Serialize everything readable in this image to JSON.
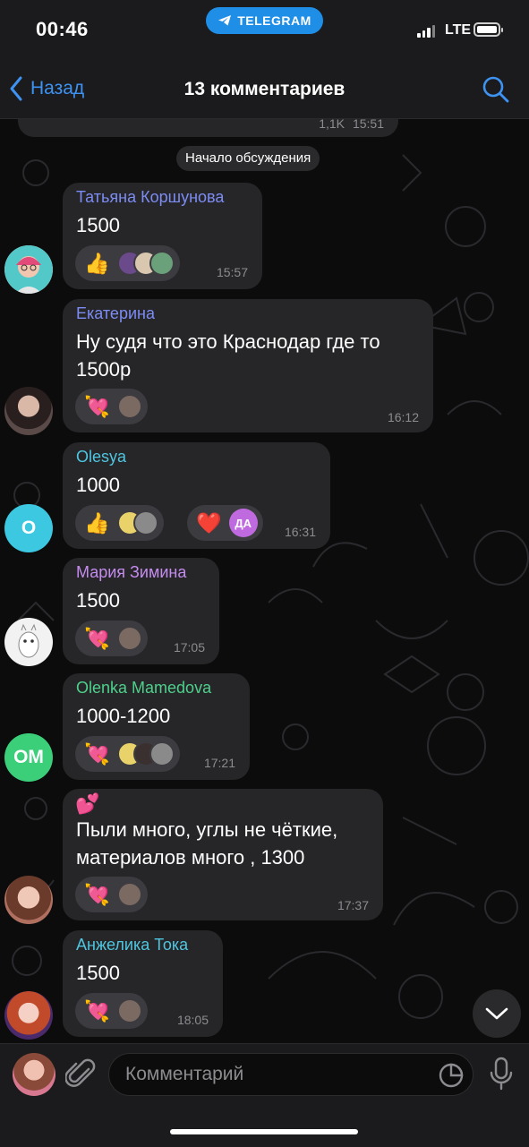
{
  "status": {
    "time": "00:46",
    "app_pill": "TELEGRAM",
    "network": "LTE"
  },
  "nav": {
    "back_label": "Назад",
    "title": "13 комментариев",
    "search_icon": "search-icon"
  },
  "partial_message": {
    "views": "1,1K",
    "time": "15:51"
  },
  "divider": "Начало обсуждения",
  "comments": [
    {
      "name": "Татьяна Коршунова",
      "name_color": "#7c8cf3",
      "text": [
        "1500"
      ],
      "time": "15:57",
      "reactions": [
        {
          "icon": "thumbs-up",
          "emoji": "👍",
          "avatars": 3
        }
      ]
    },
    {
      "name": "Екатерина",
      "name_color": "#7c8cf3",
      "text": [
        "Ну судя что это Краснодар где то",
        "1500р"
      ],
      "time": "16:12",
      "reactions": [
        {
          "icon": "heart-with-arrow",
          "emoji": "💘",
          "avatars": 1
        }
      ]
    },
    {
      "name": "Olesya",
      "name_color": "#4fc6e0",
      "avatar_letter": "O",
      "text": [
        "1000"
      ],
      "time": "16:31",
      "reactions": [
        {
          "icon": "thumbs-up",
          "emoji": "👍",
          "avatars": 2
        },
        {
          "icon": "red-heart",
          "emoji": "❤️",
          "avatar_text": "ДА"
        }
      ]
    },
    {
      "name": "Мария Зимина",
      "name_color": "#c58cf0",
      "text": [
        "1500"
      ],
      "time": "17:05",
      "reactions": [
        {
          "icon": "heart-with-arrow",
          "emoji": "💘",
          "avatars": 1
        }
      ]
    },
    {
      "name": "Olenka Mamedova",
      "name_color": "#4ed08c",
      "avatar_letter": "OM",
      "text": [
        "1000-1200"
      ],
      "time": "17:21",
      "reactions": [
        {
          "icon": "heart-with-arrow",
          "emoji": "💘",
          "avatars": 3
        }
      ]
    },
    {
      "name": "",
      "name_color": "#ffffff",
      "emoji_line": "💕",
      "text": [
        "Пыли много, углы не чёткие,",
        "материалов много , 1300"
      ],
      "time": "17:37",
      "reactions": [
        {
          "icon": "heart-with-arrow",
          "emoji": "💘",
          "avatars": 1
        }
      ]
    },
    {
      "name": "Анжелика Тока",
      "name_color": "#4fc6e0",
      "text": [
        "1500"
      ],
      "time": "18:05",
      "reactions": [
        {
          "icon": "heart-with-arrow",
          "emoji": "💘",
          "avatars": 1
        }
      ]
    }
  ],
  "composer": {
    "placeholder": "Комментарий"
  }
}
